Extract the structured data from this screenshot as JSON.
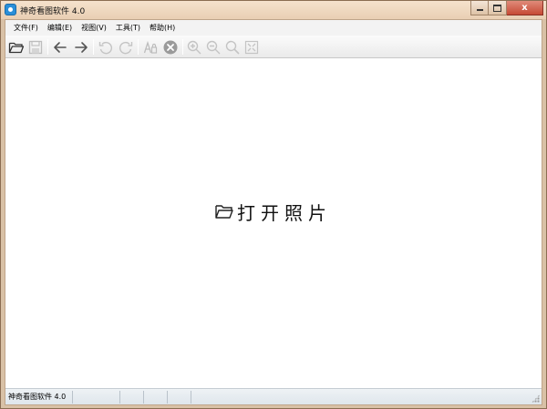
{
  "window": {
    "title": "神奇看图软件 4.0",
    "controls": {
      "minimize": "",
      "maximize": "",
      "close": "x"
    }
  },
  "menu": {
    "items": [
      {
        "label": "文件(F)"
      },
      {
        "label": "编辑(E)"
      },
      {
        "label": "视图(V)"
      },
      {
        "label": "工具(T)"
      },
      {
        "label": "帮助(H)"
      }
    ]
  },
  "toolbar": {
    "buttons": [
      {
        "icon": "folder-open-icon",
        "enabled": true
      },
      {
        "icon": "save-icon",
        "enabled": false
      },
      {
        "icon": "arrow-left-icon",
        "enabled": true
      },
      {
        "icon": "arrow-right-icon",
        "enabled": true
      },
      {
        "icon": "rotate-left-icon",
        "enabled": false
      },
      {
        "icon": "rotate-right-icon",
        "enabled": false
      },
      {
        "icon": "compare-icon",
        "enabled": false
      },
      {
        "icon": "delete-icon",
        "enabled": true
      },
      {
        "icon": "zoom-in-icon",
        "enabled": false
      },
      {
        "icon": "zoom-out-icon",
        "enabled": false
      },
      {
        "icon": "zoom-actual-icon",
        "enabled": false
      },
      {
        "icon": "fit-window-icon",
        "enabled": false
      }
    ]
  },
  "canvas": {
    "open_photo_label": "打开照片",
    "open_photo_icon": "folder-open-icon"
  },
  "statusbar": {
    "app_label": "神奇看图软件 4.0"
  },
  "colors": {
    "titlebar": "#e9cfb3",
    "close_button": "#c64a35",
    "icon_enabled": "#444444",
    "icon_disabled": "#bdbdbd",
    "app_icon": "#2a8fd8"
  }
}
